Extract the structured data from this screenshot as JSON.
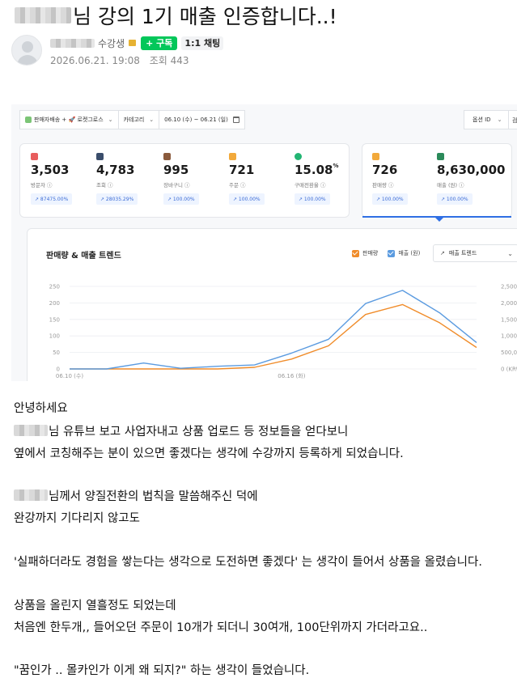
{
  "post": {
    "title_suffix": "님 강의 1기 매출 인증합니다..!",
    "author_grade": "수강생",
    "subscribe_label": "+ 구독",
    "chat_label": "1:1 채팅",
    "date": "2026.06.21. 19:08",
    "views": "조회 443"
  },
  "dashboard": {
    "filters": {
      "channel": "판매자배송 + 🚀 로켓그로스",
      "category": "카테고리",
      "date_range": "06.10 (수) ~ 06.21 (일)",
      "option": "옵션 ID",
      "option_extra": "검"
    },
    "metrics": [
      {
        "value": "3,503",
        "label": "방문자 ⓘ",
        "change": "↗ 87475.00%",
        "icon": "visitor-icon",
        "color": "#e85d5d"
      },
      {
        "value": "4,783",
        "label": "조회 ⓘ",
        "change": "↗ 28035.29%",
        "icon": "view-icon",
        "color": "#3a4d6b"
      },
      {
        "value": "995",
        "label": "장바구니 ⓘ",
        "change": "↗ 100.00%",
        "icon": "cart-icon",
        "color": "#8a5a3c"
      },
      {
        "value": "721",
        "label": "주문 ⓘ",
        "change": "↗ 100.00%",
        "icon": "order-icon",
        "color": "#f2a93b"
      },
      {
        "value": "15.08",
        "unit": "%",
        "label": "구매전환율 ⓘ",
        "change": "↗ 100.00%",
        "icon": "conversion-icon",
        "color": "#22b573"
      },
      {
        "value": "726",
        "label": "판매량 ⓘ",
        "change": "↗ 100.00%",
        "icon": "sales-qty-icon",
        "color": "#f2a93b"
      },
      {
        "value": "8,630,000",
        "label": "매출 (원) ⓘ",
        "change": "↗ 100.00%",
        "icon": "revenue-icon",
        "color": "#2b8a5a"
      }
    ],
    "chart_title": "판매량 & 매출 트렌드",
    "legend_qty": "판매량",
    "legend_rev": "매출 (원)",
    "trend_select": "매출 트렌드"
  },
  "chart_data": {
    "type": "line",
    "title": "판매량 & 매출 트렌드",
    "x": [
      "06.10 (수)",
      "06.11",
      "06.12",
      "06.13",
      "06.14",
      "06.15",
      "06.16 (화)",
      "06.17",
      "06.18",
      "06.19",
      "06.20",
      "06.21"
    ],
    "x_tick_labels": [
      "06.10 (수)",
      "06.16 (화)"
    ],
    "series": [
      {
        "name": "판매량",
        "axis": "left",
        "color": "#f08c2a",
        "values": [
          0,
          0,
          0,
          0,
          0,
          5,
          30,
          70,
          165,
          195,
          140,
          65
        ]
      },
      {
        "name": "매출 (원)",
        "axis": "right",
        "color": "#5b9be0",
        "values": [
          0,
          0,
          180000,
          20000,
          80000,
          120000,
          480000,
          900000,
          1980000,
          2380000,
          1700000,
          800000
        ]
      }
    ],
    "ylim_left": [
      0,
      250
    ],
    "yticks_left": [
      "250",
      "200",
      "150",
      "100",
      "50",
      "0"
    ],
    "ylim_right": [
      0,
      2500000
    ],
    "yticks_right": [
      "2,500,000",
      "2,000,000",
      "1,500,000",
      "1,000,000",
      "500,000",
      "0 (KRW)"
    ],
    "grid": true
  },
  "body": {
    "lines": [
      {
        "text": "안녕하세요",
        "blur": false
      },
      {
        "text": "님 유튜브 보고 사업자내고 상품 업로드 등 정보들을 얻다보니",
        "blur": true
      },
      {
        "text": "옆에서 코칭해주는 분이 있으면 좋겠다는 생각에 수강까지 등록하게 되었습니다.",
        "blur": false
      },
      {
        "text": "님께서 양질전환의 법칙을 말씀해주신 덕에",
        "blur": true
      },
      {
        "text": "완강까지 기다리지 않고도",
        "blur": false
      },
      {
        "text": "'실패하더라도 경험을 쌓는다는 생각으로 도전하면 좋겠다' 는 생각이 들어서 상품을 올렸습니다.",
        "blur": false
      },
      {
        "text": "상품을 올린지 열흘정도 되었는데",
        "blur": false
      },
      {
        "text": "처음엔 한두개,, 들어오던 주문이 10개가 되더니 30여개, 100단위까지 가더라고요..",
        "blur": false
      },
      {
        "text": "\"꿈인가 .. 몰카인가 이게 왜 되지?\" 하는 생각이 들었습니다.",
        "blur": false
      }
    ]
  }
}
